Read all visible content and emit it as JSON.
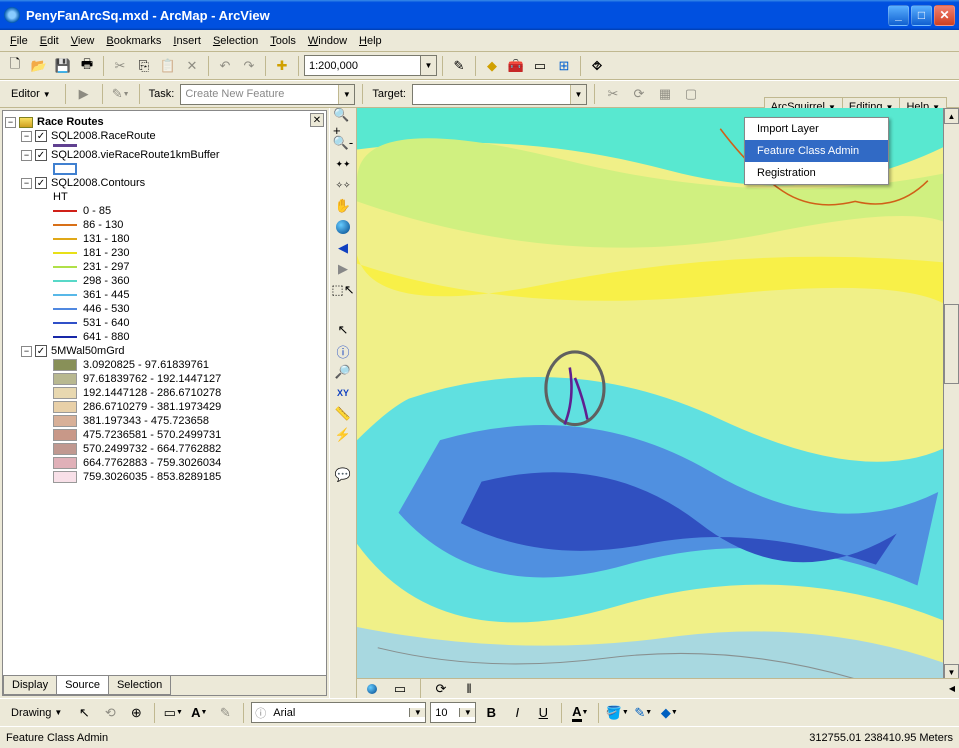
{
  "window": {
    "title": "PenyFanArcSq.mxd - ArcMap - ArcView"
  },
  "menubar": [
    "File",
    "Edit",
    "View",
    "Bookmarks",
    "Insert",
    "Selection",
    "Tools",
    "Window",
    "Help"
  ],
  "scale": "1:200,000",
  "editor": {
    "label": "Editor",
    "task_label": "Task:",
    "task_value": "Create New Feature",
    "target_label": "Target:",
    "target_value": ""
  },
  "right_menus": [
    "ArcSquirrel",
    "Editing",
    "Help"
  ],
  "arcsquirrel_menu": [
    "Import Layer",
    "Feature Class Admin",
    "Registration"
  ],
  "arcsquirrel_selected": 1,
  "toc": {
    "root": "Race Routes",
    "layers": [
      {
        "name": "SQL2008.RaceRoute",
        "expanded": true,
        "symbol": {
          "type": "line",
          "color": "#604090"
        }
      },
      {
        "name": "SQL2008.vieRaceRoute1kmBuffer",
        "expanded": true,
        "symbol": {
          "type": "box",
          "fill": "#fff",
          "border": "#4080d0"
        }
      },
      {
        "name": "SQL2008.Contours",
        "expanded": true,
        "field": "HT",
        "classes": [
          {
            "label": "0 - 85",
            "color": "#d02018"
          },
          {
            "label": "86 - 130",
            "color": "#d87018"
          },
          {
            "label": "131 - 180",
            "color": "#e0a818"
          },
          {
            "label": "181 - 230",
            "color": "#e8e018"
          },
          {
            "label": "231 - 297",
            "color": "#b0e048"
          },
          {
            "label": "298 - 360",
            "color": "#58d8c8"
          },
          {
            "label": "361 - 445",
            "color": "#58b8e8"
          },
          {
            "label": "446 - 530",
            "color": "#5088e0"
          },
          {
            "label": "531 - 640",
            "color": "#3050c8"
          },
          {
            "label": "641 - 880",
            "color": "#1828a8"
          }
        ]
      },
      {
        "name": "5MWal50mGrd",
        "expanded": true,
        "classes_poly": [
          {
            "label": "3.0920825 - 97.61839761",
            "color": "#889058"
          },
          {
            "label": "97.61839762 - 192.1447127",
            "color": "#b8b890"
          },
          {
            "label": "192.1447128 - 286.6710278",
            "color": "#e8d8b0"
          },
          {
            "label": "286.6710279 - 381.1973429",
            "color": "#e8d0a8"
          },
          {
            "label": "381.197343 - 475.723658",
            "color": "#d8b098"
          },
          {
            "label": "475.7236581 - 570.2499731",
            "color": "#c89888"
          },
          {
            "label": "570.2499732 - 664.7762882",
            "color": "#c09890"
          },
          {
            "label": "664.7762883 - 759.3026034",
            "color": "#e0b0b8"
          },
          {
            "label": "759.3026035 - 853.8289185",
            "color": "#f8e0e8"
          }
        ]
      }
    ],
    "tabs": [
      "Display",
      "Source",
      "Selection"
    ],
    "active_tab": 1
  },
  "drawing": {
    "label": "Drawing",
    "font": "Arial",
    "size": "10"
  },
  "status": {
    "text": "Feature Class Admin",
    "coords": "312755.01 238410.95 Meters"
  }
}
